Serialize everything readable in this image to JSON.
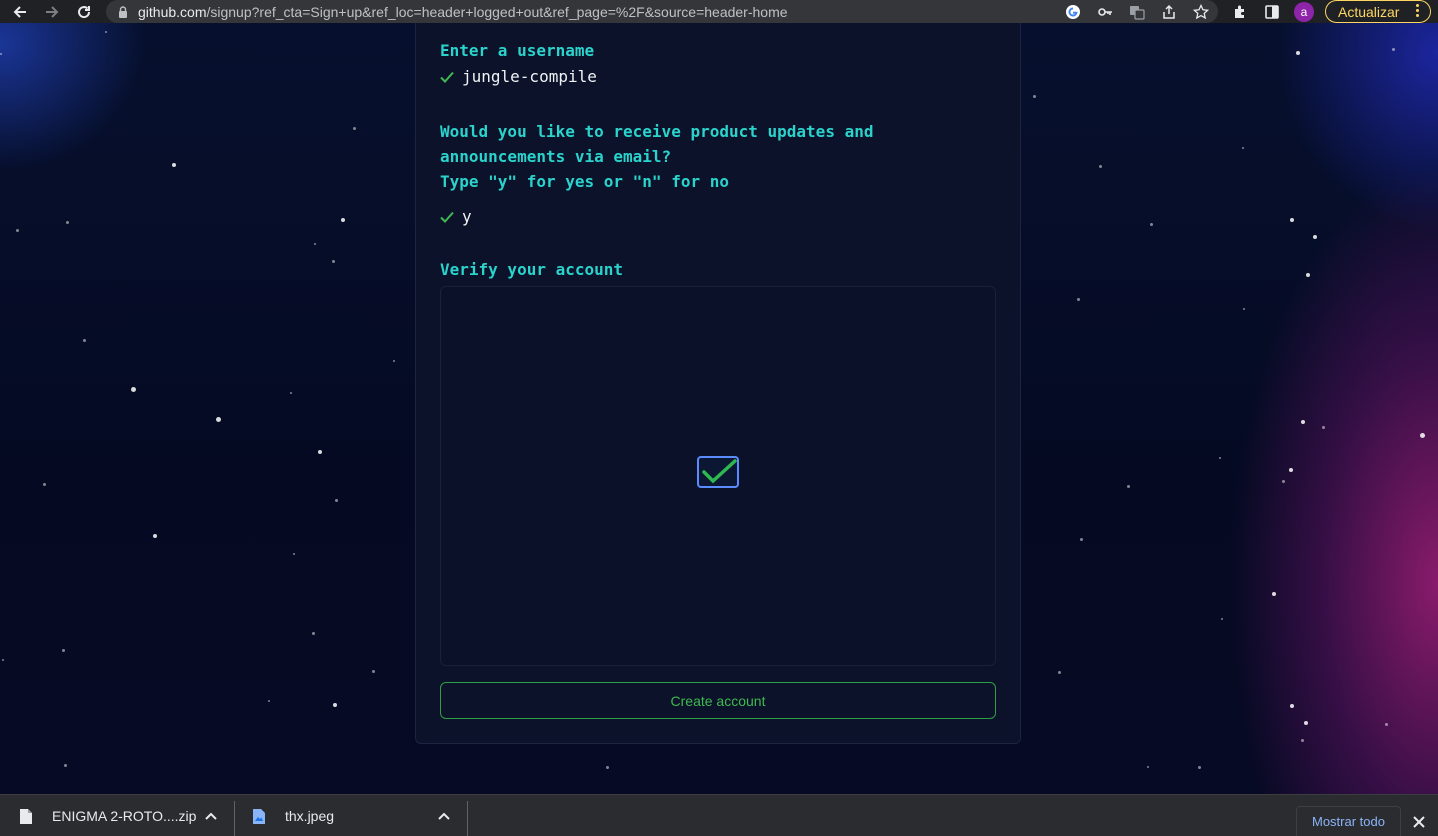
{
  "browser": {
    "url_host": "github.com",
    "url_path": "/signup?ref_cta=Sign+up&ref_loc=header+logged+out&ref_page=%2F&source=header-home",
    "profile_initial": "a",
    "update_label": "Actualizar"
  },
  "signup": {
    "username_prompt": "Enter a username",
    "username_value": "jungle-compile",
    "email_prompt_line1": "Would you like to receive product updates and",
    "email_prompt_line2": "announcements via email?",
    "email_prompt_line3": "Type \"y\" for yes or \"n\" for no",
    "email_value": "y",
    "verify_prompt": "Verify your account",
    "create_account_label": "Create account"
  },
  "downloads": {
    "items": [
      {
        "name": "ENIGMA 2-ROTO....zip"
      },
      {
        "name": "thx.jpeg"
      }
    ],
    "show_all_label": "Mostrar todo"
  },
  "colors": {
    "accent_cyan": "#2ad3cc",
    "success_green": "#3fb950",
    "update_yellow": "#fdd663"
  }
}
